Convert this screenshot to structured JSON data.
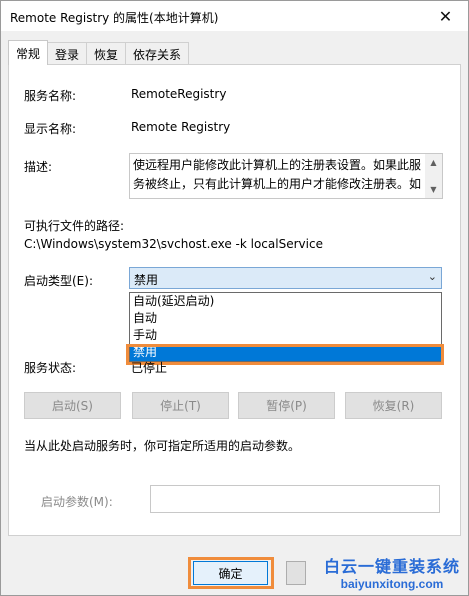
{
  "window": {
    "title": "Remote Registry 的属性(本地计算机)",
    "close_glyph": "✕"
  },
  "tabs": [
    {
      "label": "常规",
      "active": true
    },
    {
      "label": "登录",
      "active": false
    },
    {
      "label": "恢复",
      "active": false
    },
    {
      "label": "依存关系",
      "active": false
    }
  ],
  "general": {
    "service_name_label": "服务名称:",
    "service_name_value": "RemoteRegistry",
    "display_name_label": "显示名称:",
    "display_name_value": "Remote Registry",
    "description_label": "描述:",
    "description_value": "使远程用户能修改此计算机上的注册表设置。如果此服务被终止，只有此计算机上的用户才能修改注册表。如",
    "exe_path_label": "可执行文件的路径:",
    "exe_path_value": "C:\\Windows\\system32\\svchost.exe -k localService",
    "startup_type_label": "启动类型(E):",
    "startup_type_selected": "禁用",
    "startup_type_options": [
      "自动(延迟启动)",
      "自动",
      "手动",
      "禁用"
    ],
    "service_status_label": "服务状态:",
    "service_status_value": "已停止",
    "buttons": {
      "start": "启动(S)",
      "stop": "停止(T)",
      "pause": "暂停(P)",
      "resume": "恢复(R)"
    },
    "hint_text": "当从此处启动服务时，你可指定所适用的启动参数。",
    "start_params_label": "启动参数(M):",
    "start_params_value": ""
  },
  "footer": {
    "ok_label": "确定"
  },
  "watermark": {
    "cn": "白云一键重装系统",
    "en": "baiyunxitong.com"
  },
  "colors": {
    "highlight": "#f08c3b",
    "selection": "#0078d7",
    "watermark": "#2a6cd6"
  }
}
